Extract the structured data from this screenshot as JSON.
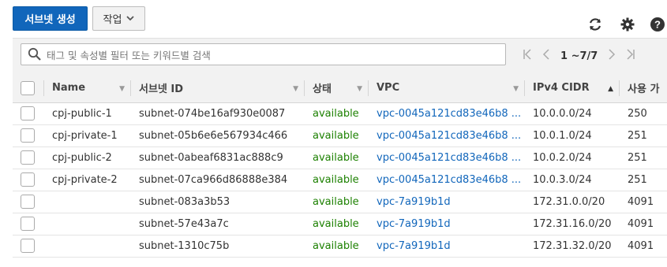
{
  "toolbar": {
    "create_label": "서브넷 생성",
    "actions_label": "작업",
    "refresh_icon": "refresh-icon",
    "settings_icon": "gear-icon",
    "help_icon": "help-icon"
  },
  "filter": {
    "placeholder": "태그 및 속성별 필터 또는 키워드별 검색"
  },
  "pager": {
    "range": "1 ~7/7"
  },
  "table": {
    "columns": [
      "Name",
      "서브넷 ID",
      "상태",
      "VPC",
      "IPv4 CIDR",
      "사용 가"
    ],
    "rows": [
      {
        "name": "cpj-public-1",
        "subnet_id": "subnet-074be16af930e0087",
        "state": "available",
        "vpc": "vpc-0045a121cd83e46b8 ...",
        "cidr": "10.0.0.0/24",
        "avail": "250"
      },
      {
        "name": "cpj-private-1",
        "subnet_id": "subnet-05b6e6e567934c466",
        "state": "available",
        "vpc": "vpc-0045a121cd83e46b8 ...",
        "cidr": "10.0.1.0/24",
        "avail": "251"
      },
      {
        "name": "cpj-public-2",
        "subnet_id": "subnet-0abeaf6831ac888c9",
        "state": "available",
        "vpc": "vpc-0045a121cd83e46b8 ...",
        "cidr": "10.0.2.0/24",
        "avail": "251"
      },
      {
        "name": "cpj-private-2",
        "subnet_id": "subnet-07ca966d86888e384",
        "state": "available",
        "vpc": "vpc-0045a121cd83e46b8 ...",
        "cidr": "10.0.3.0/24",
        "avail": "251"
      },
      {
        "name": "",
        "subnet_id": "subnet-083a3b53",
        "state": "available",
        "vpc": "vpc-7a919b1d",
        "cidr": "172.31.0.0/20",
        "avail": "4091"
      },
      {
        "name": "",
        "subnet_id": "subnet-57e43a7c",
        "state": "available",
        "vpc": "vpc-7a919b1d",
        "cidr": "172.31.16.0/20",
        "avail": "4091"
      },
      {
        "name": "",
        "subnet_id": "subnet-1310c75b",
        "state": "available",
        "vpc": "vpc-7a919b1d",
        "cidr": "172.31.32.0/20",
        "avail": "4091"
      }
    ]
  },
  "colors": {
    "primary": "#1166bb",
    "status_ok": "#1d8102",
    "link": "#1166bb"
  }
}
